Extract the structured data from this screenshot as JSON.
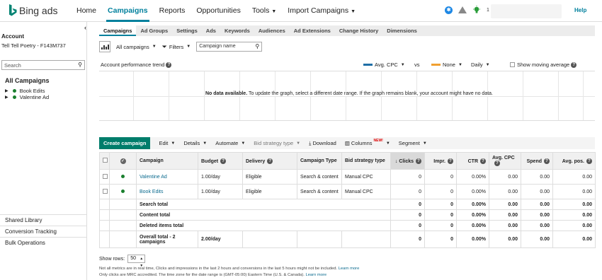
{
  "brand": {
    "name": "Bing ads"
  },
  "nav": [
    {
      "label": "Home",
      "active": false,
      "caret": false
    },
    {
      "label": "Campaigns",
      "active": true,
      "caret": false
    },
    {
      "label": "Reports",
      "active": false,
      "caret": false
    },
    {
      "label": "Opportunities",
      "active": false,
      "caret": false
    },
    {
      "label": "Tools",
      "active": false,
      "caret": true
    },
    {
      "label": "Import Campaigns",
      "active": false,
      "caret": true
    }
  ],
  "top_icons": {
    "bulb_count": "1"
  },
  "help": "Help",
  "sidebar": {
    "account_label": "Account",
    "account_name": "Tell Tell Poetry - F143M737",
    "search_placeholder": "Search",
    "all_campaigns": "All Campaigns",
    "campaigns": [
      "Book Edits",
      "Valentine Ad"
    ],
    "links": [
      "Shared Library",
      "Conversion Tracking",
      "Bulk Operations"
    ]
  },
  "tabs": [
    "Campaigns",
    "Ad Groups",
    "Settings",
    "Ads",
    "Keywords",
    "Audiences",
    "Ad Extensions",
    "Change History",
    "Dimensions"
  ],
  "filters": {
    "scope": "All campaigns",
    "filters_label": "Filters",
    "search_value": "Campaign name"
  },
  "trend": {
    "title": "Account performance trend",
    "metric1": "Avg. CPC",
    "vs": "vs",
    "metric2": "None",
    "period": "Daily",
    "moving_avg": "Show moving average",
    "colors": {
      "metric1": "#1f6fa6",
      "metric2": "#f0a030"
    },
    "nodata_bold": "No data available.",
    "nodata_text": " To update the graph, select a different date range. If the graph remains blank, your account might have no data."
  },
  "toolbar": {
    "create": "Create campaign",
    "edit": "Edit",
    "details": "Details",
    "automate": "Automate",
    "bid_strategy": "Bid strategy type",
    "download": "Download",
    "columns": "Columns",
    "new_badge": "NEW!",
    "segment": "Segment"
  },
  "table": {
    "headers": {
      "campaign": "Campaign",
      "budget": "Budget",
      "delivery": "Delivery",
      "campaign_type": "Campaign Type",
      "bid_strategy": "Bid strategy type",
      "clicks": "Clicks",
      "impr": "Impr.",
      "ctr": "CTR",
      "avg_cpc": "Avg. CPC",
      "spend": "Spend",
      "avg_pos": "Avg. pos."
    },
    "rows": [
      {
        "campaign": "Valentine Ad",
        "budget": "1.00/day",
        "delivery": "Eligible",
        "type": "Search & content",
        "bid": "Manual CPC",
        "clicks": "0",
        "impr": "0",
        "ctr": "0.00%",
        "avg_cpc": "0.00",
        "spend": "0.00",
        "avg_pos": "0.00"
      },
      {
        "campaign": "Book Edits",
        "budget": "1.00/day",
        "delivery": "Eligible",
        "type": "Search & content",
        "bid": "Manual CPC",
        "clicks": "0",
        "impr": "0",
        "ctr": "0.00%",
        "avg_cpc": "0.00",
        "spend": "0.00",
        "avg_pos": "0.00"
      }
    ],
    "summary": [
      {
        "label": "Search total",
        "clicks": "0",
        "impr": "0",
        "ctr": "0.00%",
        "avg_cpc": "0.00",
        "spend": "0.00",
        "avg_pos": "0.00"
      },
      {
        "label": "Content total",
        "clicks": "0",
        "impr": "0",
        "ctr": "0.00%",
        "avg_cpc": "0.00",
        "spend": "0.00",
        "avg_pos": "0.00"
      },
      {
        "label": "Deleted items total",
        "clicks": "0",
        "impr": "0",
        "ctr": "0.00%",
        "avg_cpc": "0.00",
        "spend": "0.00",
        "avg_pos": "0.00"
      }
    ],
    "overall": {
      "label": "Overall total - 2 campaigns",
      "budget": "2.00/day",
      "clicks": "0",
      "impr": "0",
      "ctr": "0.00%",
      "avg_cpc": "0.00",
      "spend": "0.00",
      "avg_pos": "0.00"
    }
  },
  "show_rows": {
    "label": "Show rows:",
    "value": "50"
  },
  "footnotes": [
    {
      "text": "Not all metrics are in real time, Clicks and impressions in the last 2 hours and conversions in the last 5 hours might not be included.",
      "link": "Learn more"
    },
    {
      "text": "Only clicks are MRC accredited. The time zone for the date range is (GMT-05:00) Eastern Time (U.S. & Canada).",
      "link": "Learn more"
    }
  ]
}
